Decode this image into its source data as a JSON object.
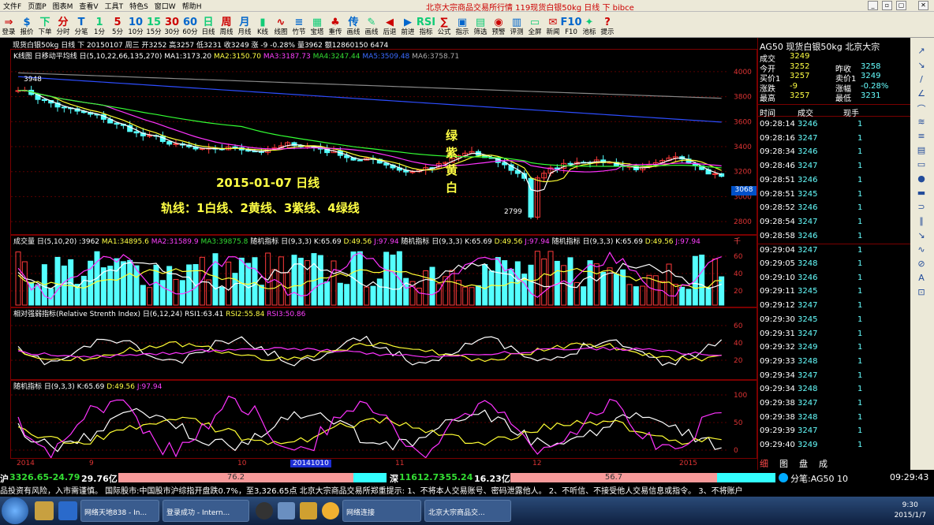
{
  "menu": {
    "items": [
      "文件F",
      "页面P",
      "图表M",
      "查看V",
      "工具T",
      "特色S",
      "窗口W",
      "帮助H"
    ],
    "window_title": "北京大宗商品交易所行情 119现货白银50kg 日线 下 bibce"
  },
  "toolbar": [
    {
      "g": "⇒",
      "l": "登录"
    },
    {
      "g": "$",
      "l": "报价"
    },
    {
      "g": "下",
      "l": "下单"
    },
    {
      "g": "分",
      "l": "分时"
    },
    {
      "g": "T",
      "l": "分笔"
    },
    {
      "g": "1",
      "l": "1分"
    },
    {
      "g": "5",
      "l": "5分"
    },
    {
      "g": "10",
      "l": "10分"
    },
    {
      "g": "15",
      "l": "15分"
    },
    {
      "g": "30",
      "l": "30分"
    },
    {
      "g": "60",
      "l": "60分"
    },
    {
      "g": "日",
      "l": "日线"
    },
    {
      "g": "周",
      "l": "周线"
    },
    {
      "g": "月",
      "l": "月线"
    },
    {
      "g": "▮",
      "l": "K线"
    },
    {
      "g": "∿",
      "l": "线图"
    },
    {
      "g": "≡",
      "l": "竹节"
    },
    {
      "g": "▦",
      "l": "宝塔"
    },
    {
      "g": "♣",
      "l": "重传"
    },
    {
      "g": "传",
      "l": "画线"
    },
    {
      "g": "✎",
      "l": "画线"
    },
    {
      "g": "◀",
      "l": "后退"
    },
    {
      "g": "▶",
      "l": "前进"
    },
    {
      "g": "RSI",
      "l": "指标"
    },
    {
      "g": "∑",
      "l": "公式"
    },
    {
      "g": "▣",
      "l": "指示"
    },
    {
      "g": "▤",
      "l": "筛选"
    },
    {
      "g": "◉",
      "l": "预警"
    },
    {
      "g": "▥",
      "l": "评测"
    },
    {
      "g": "▭",
      "l": "全屏"
    },
    {
      "g": "✉",
      "l": "新闻"
    },
    {
      "g": "F10",
      "l": "F10"
    },
    {
      "g": "✦",
      "l": "池标"
    },
    {
      "g": "?",
      "l": "提示"
    }
  ],
  "chart": {
    "header": "现货白银50kg 日线 下 20150107 周三 开3252 高3257 低3231 收3249 涨 -9 -0.28% 量3962 额12860150 6474",
    "ma_labels": {
      "title": "K线图 日移动平均线 日(5,10,22,66,135,270)",
      "ma1": "MA1:3173.20",
      "ma2": "MA2:3150.70",
      "ma3": "MA3:3187.73",
      "ma4": "MA4:3247.44",
      "ma5": "MA5:3509.48",
      "ma6": "MA6:3758.71"
    },
    "price_ticks": [
      "4000",
      "3800",
      "3600",
      "3400",
      "3200",
      "3000",
      "2800"
    ],
    "current_price": "3068",
    "high_mark": "3948",
    "low_mark": "2799",
    "annotations": {
      "date": "2015-01-07 日线",
      "rails": "轨线：1白线、2黄线、3紫线、4绿线",
      "colors": [
        "绿",
        "紫",
        "黄",
        "白"
      ]
    },
    "volume_labels": {
      "a": "成交量 日(5,10,20) :3962",
      "ma1": "MA1:34895.6",
      "ma2": "MA2:31589.9",
      "ma3": "MA3:39875.8",
      "b": "随机指标 日(9,3,3) K:65.69",
      "d": "D:49.56",
      "j": "J:97.94",
      "c": "随机指标 日(9,3,3) K:65.69",
      "d2": "D:49.56",
      "j2": "J:97.94",
      "e": "随机指标 日(9,3,3) K:65.69",
      "d3": "D:49.56",
      "j3": "J:97.94",
      "unit": "千"
    },
    "vol_ticks": [
      "60",
      "40",
      "20"
    ],
    "rsi_labels": {
      "a": "相对强弱指标(Relative Strenth Index) 日(6,12,24)",
      "r1": "RSI1:63.41",
      "r2": "RSI2:55.84",
      "r3": "RSI3:50.86"
    },
    "rsi_ticks": [
      "60",
      "40",
      "20"
    ],
    "kdj_labels": {
      "a": "随机指标 日(9,3,3)",
      "k": "K:65.69",
      "d": "D:49.56",
      "j": "J:97.94"
    },
    "kdj_ticks": [
      "100",
      "50",
      "0"
    ],
    "x_labels": [
      "2014",
      "9",
      "10",
      "20141010",
      "11",
      "12",
      "2015"
    ]
  },
  "quote": {
    "title": "AG50 现货白银50kg 北京大宗",
    "rows": [
      {
        "k": "成交",
        "v": "3249",
        "k2": "",
        "v2": ""
      },
      {
        "k": "今开",
        "v": "3252",
        "k2": "昨收",
        "v2": "3258"
      },
      {
        "k": "买价1",
        "v": "3257",
        "k2": "卖价1",
        "v2": "3249"
      },
      {
        "k": "涨跌",
        "v": "-9",
        "k2": "涨幅",
        "v2": "-0.28%"
      },
      {
        "k": "最高",
        "v": "3257",
        "k2": "最低",
        "v2": "3231"
      }
    ],
    "tick_header": {
      "time": "时间",
      "price": "成交",
      "vol": "现手"
    },
    "ticks": [
      [
        "09:28:14",
        "3246",
        "1"
      ],
      [
        "09:28:16",
        "3247",
        "1"
      ],
      [
        "09:28:34",
        "3246",
        "1"
      ],
      [
        "09:28:46",
        "3247",
        "1"
      ],
      [
        "09:28:51",
        "3246",
        "1"
      ],
      [
        "09:28:51",
        "3245",
        "1"
      ],
      [
        "09:28:52",
        "3246",
        "1"
      ],
      [
        "09:28:54",
        "3247",
        "1"
      ],
      [
        "09:28:58",
        "3246",
        "1"
      ],
      [
        "09:29:04",
        "3247",
        "1"
      ],
      [
        "09:29:05",
        "3248",
        "1"
      ],
      [
        "09:29:10",
        "3246",
        "1"
      ],
      [
        "09:29:11",
        "3245",
        "1"
      ],
      [
        "09:29:12",
        "3247",
        "1"
      ],
      [
        "09:29:30",
        "3245",
        "1"
      ],
      [
        "09:29:31",
        "3247",
        "1"
      ],
      [
        "09:29:32",
        "3249",
        "1"
      ],
      [
        "09:29:33",
        "3248",
        "1"
      ],
      [
        "09:29:34",
        "3247",
        "1"
      ],
      [
        "09:29:34",
        "3248",
        "1"
      ],
      [
        "09:29:38",
        "3247",
        "1"
      ],
      [
        "09:29:38",
        "3248",
        "1"
      ],
      [
        "09:29:39",
        "3247",
        "1"
      ],
      [
        "09:29:40",
        "3249",
        "1"
      ]
    ],
    "tabs": [
      "细",
      "图",
      "盘",
      "成"
    ]
  },
  "status": {
    "sh_label": "沪",
    "sh": "3326.65",
    "sh_chg": "-24.79",
    "sh_amt": "29.76亿",
    "sh_bar": "76.2",
    "sz_label": "深",
    "sz": "11612.73",
    "sz_chg": "-55.24",
    "sz_amt": "16.23亿",
    "sz_bar": "56.7",
    "code": "分笔:AG50 10",
    "time": "09:29:43"
  },
  "news": "品投资有风险，入市需谨慎。     国际股市:中国股市沪综指开盘跌0.7%，至3,326.65点     北京大宗商品交易所郑重提示:    1、不将本人交易账号、密码泄露他人。     2、不听信、不接受他人交易信息或指令。     3、不将账户",
  "taskbar": {
    "items": [
      "网络天地838 - In...",
      "登录成功 - Intern...",
      "网络连接",
      "北京大宗商品交..."
    ],
    "clock": "9:30",
    "date": "2015/1/7"
  }
}
